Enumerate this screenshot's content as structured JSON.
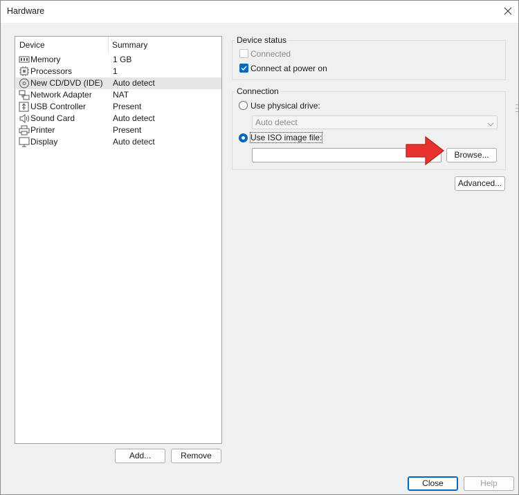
{
  "window": {
    "title": "Hardware"
  },
  "devices": {
    "columns": {
      "device": "Device",
      "summary": "Summary"
    },
    "items": [
      {
        "name": "Memory",
        "summary": "1 GB",
        "icon": "memory-icon"
      },
      {
        "name": "Processors",
        "summary": "1",
        "icon": "processor-icon"
      },
      {
        "name": "New CD/DVD (IDE)",
        "summary": "Auto detect",
        "icon": "cd-dvd-icon",
        "selected": true
      },
      {
        "name": "Network Adapter",
        "summary": "NAT",
        "icon": "network-adapter-icon"
      },
      {
        "name": "USB Controller",
        "summary": "Present",
        "icon": "usb-icon"
      },
      {
        "name": "Sound Card",
        "summary": "Auto detect",
        "icon": "speaker-icon"
      },
      {
        "name": "Printer",
        "summary": "Present",
        "icon": "printer-icon"
      },
      {
        "name": "Display",
        "summary": "Auto detect",
        "icon": "display-icon"
      }
    ],
    "add_label": "Add...",
    "remove_label": "Remove"
  },
  "device_status": {
    "title": "Device status",
    "connected_label": "Connected",
    "connected_checked": false,
    "connect_at_power_on_label": "Connect at power on",
    "connect_at_power_on_checked": true
  },
  "connection": {
    "title": "Connection",
    "physical_drive_label": "Use physical drive:",
    "physical_drive_value": "Auto detect",
    "iso_label": "Use ISO image file:",
    "iso_path": "",
    "browse_label": "Browse...",
    "selected": "iso"
  },
  "advanced_label": "Advanced...",
  "footer": {
    "close_label": "Close",
    "help_label": "Help"
  },
  "colors": {
    "accent": "#0067c0",
    "arrow": "#e8322e"
  }
}
